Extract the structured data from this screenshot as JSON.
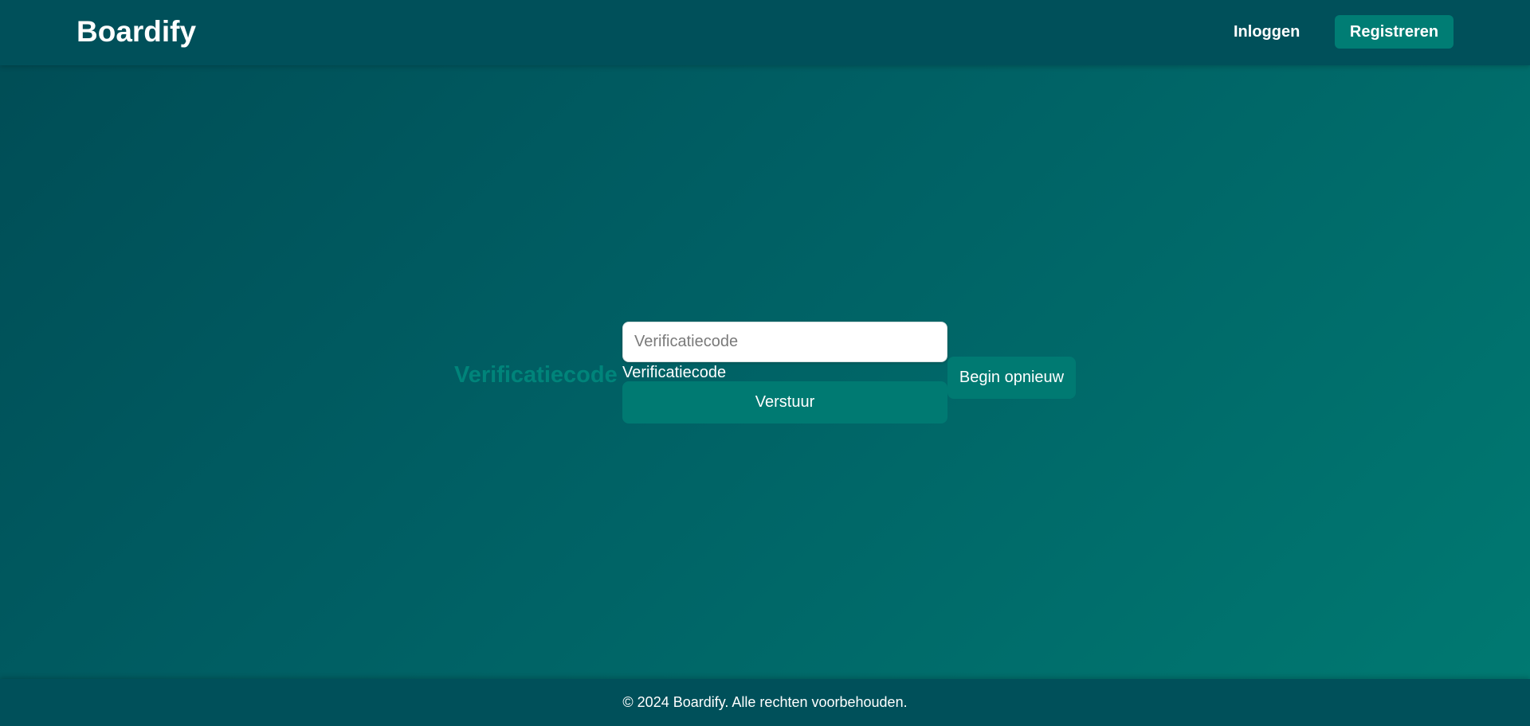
{
  "header": {
    "brand": "Boardify",
    "login_label": "Inloggen",
    "register_label": "Registreren"
  },
  "form": {
    "side_title": "Verificatiecode",
    "code_placeholder": "Verificatiecode",
    "code_value": "",
    "code_label": "Verificatiecode",
    "submit_label": "Verstuur",
    "restart_label": "Begin opnieuw"
  },
  "footer": {
    "copyright": "© 2024 Boardify. Alle rechten voorbehouden."
  },
  "colors": {
    "header_bg": "#00505a",
    "accent": "#007a72",
    "side_title": "#00847a",
    "background_start": "#004c55",
    "background_end": "#007a72"
  }
}
